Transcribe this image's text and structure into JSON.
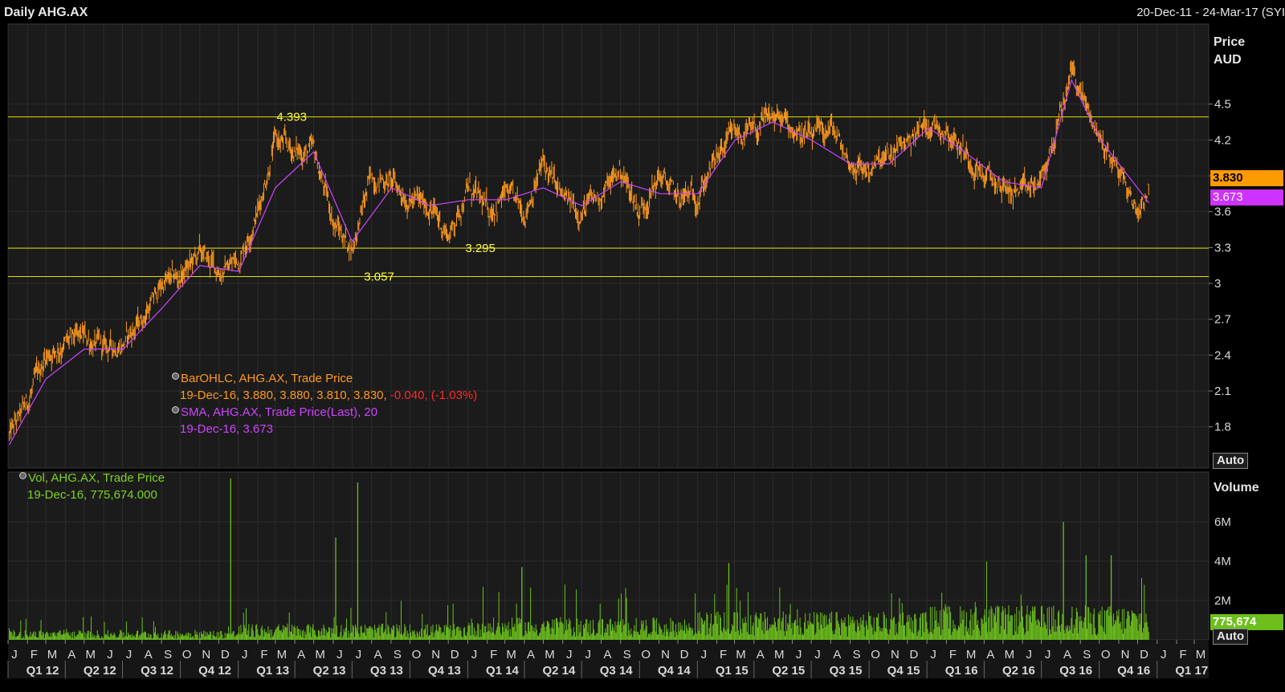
{
  "header": {
    "title": "Daily AHG.AX",
    "date_range": "20-Dec-11 - 24-Mar-17 (SYI"
  },
  "price_panel": {
    "axis_label_line1": "Price",
    "axis_label_line2": "AUD",
    "y_ticks": [
      "4.5",
      "4.2",
      "3.9",
      "3.6",
      "3.3",
      "3",
      "2.7",
      "2.4",
      "2.1",
      "1.8"
    ],
    "auto_label": "Auto",
    "last_price_tag": "3.830",
    "sma_tag": "3.673",
    "tag_colors": {
      "price": "#ff9a00",
      "sma": "#cc33ff"
    }
  },
  "volume_panel": {
    "axis_label": "Volume",
    "y_ticks": [
      "6M",
      "4M",
      "2M"
    ],
    "last_volume_tag": "775,674",
    "auto_label": "Auto"
  },
  "legend": {
    "bar_title": "BarOHLC, AHG.AX, Trade Price",
    "bar_values": "19-Dec-16, 3.880, 3.880, 3.810, 3.830,",
    "bar_change": "-0.040, (-1.03%)",
    "sma_title": "SMA, AHG.AX, Trade Price(Last),  20",
    "sma_values": "19-Dec-16, 3.673",
    "vol_title": "Vol, AHG.AX, Trade Price",
    "vol_values": "19-Dec-16, 775,674.000"
  },
  "chart_data": {
    "type": "bar",
    "subtype": "ohlc",
    "title": "Daily AHG.AX",
    "x_range": [
      "2012-01-01",
      "2017-03-24"
    ],
    "ylim": [
      1.6,
      4.9
    ],
    "ylabel": "Price AUD",
    "grid": true,
    "levels": [
      {
        "label": "4.393",
        "value": 4.393
      },
      {
        "label": "3.295",
        "value": 3.295
      },
      {
        "label": "3.057",
        "value": 3.057
      }
    ],
    "price_series": {
      "name": "BarOHLC, AHG.AX, Trade Price",
      "color": "#ff9a1f",
      "x": [
        "2012-01-03",
        "2012-02-01",
        "2012-03-01",
        "2012-04-02",
        "2012-05-01",
        "2012-06-01",
        "2012-07-02",
        "2012-08-01",
        "2012-09-03",
        "2012-10-01",
        "2012-11-01",
        "2012-12-03",
        "2013-01-02",
        "2013-02-01",
        "2013-03-01",
        "2013-04-02",
        "2013-05-01",
        "2013-06-03",
        "2013-07-01",
        "2013-08-01",
        "2013-09-02",
        "2013-10-01",
        "2013-11-01",
        "2013-12-02",
        "2014-01-02",
        "2014-02-03",
        "2014-03-03",
        "2014-04-01",
        "2014-05-01",
        "2014-06-02",
        "2014-07-01",
        "2014-08-01",
        "2014-09-01",
        "2014-10-01",
        "2014-11-03",
        "2014-12-01",
        "2015-01-02",
        "2015-02-02",
        "2015-03-02",
        "2015-04-01",
        "2015-05-01",
        "2015-06-01",
        "2015-07-01",
        "2015-08-03",
        "2015-09-01",
        "2015-10-01",
        "2015-11-02",
        "2015-12-01",
        "2016-01-04",
        "2016-02-01",
        "2016-03-01",
        "2016-04-01",
        "2016-05-02",
        "2016-06-01",
        "2016-07-01",
        "2016-08-01",
        "2016-08-18",
        "2016-09-01",
        "2016-10-03",
        "2016-11-01",
        "2016-12-01",
        "2016-12-19"
      ],
      "close": [
        1.72,
        2.0,
        2.4,
        2.5,
        2.55,
        2.45,
        2.5,
        2.7,
        3.0,
        3.05,
        3.25,
        3.1,
        3.2,
        3.6,
        4.2,
        4.1,
        4.1,
        3.5,
        3.3,
        3.9,
        3.85,
        3.7,
        3.65,
        3.4,
        3.8,
        3.6,
        3.75,
        3.6,
        4.0,
        3.7,
        3.6,
        3.75,
        3.95,
        3.6,
        3.9,
        3.7,
        3.75,
        4.05,
        4.25,
        4.25,
        4.4,
        4.3,
        4.2,
        4.3,
        4.0,
        3.95,
        4.05,
        4.2,
        4.35,
        4.3,
        4.1,
        3.9,
        3.8,
        3.75,
        3.85,
        4.4,
        4.8,
        4.6,
        4.2,
        3.95,
        3.6,
        3.83
      ]
    },
    "sma_series": {
      "name": "SMA, AHG.AX, Trade Price(Last),  20",
      "color": "#cc44ff",
      "x": [
        "2012-01-03",
        "2012-03-01",
        "2012-05-01",
        "2012-07-02",
        "2012-09-03",
        "2012-11-01",
        "2013-01-02",
        "2013-03-01",
        "2013-05-01",
        "2013-07-01",
        "2013-09-02",
        "2013-11-01",
        "2014-01-02",
        "2014-03-03",
        "2014-05-01",
        "2014-07-01",
        "2014-09-01",
        "2014-11-03",
        "2015-01-02",
        "2015-03-02",
        "2015-05-01",
        "2015-07-01",
        "2015-09-01",
        "2015-11-02",
        "2016-01-04",
        "2016-03-01",
        "2016-05-02",
        "2016-07-01",
        "2016-08-18",
        "2016-10-03",
        "2016-12-19"
      ],
      "values": [
        1.65,
        2.2,
        2.45,
        2.45,
        2.8,
        3.15,
        3.1,
        3.8,
        4.1,
        3.35,
        3.8,
        3.65,
        3.7,
        3.7,
        3.8,
        3.65,
        3.85,
        3.75,
        3.75,
        4.2,
        4.35,
        4.2,
        4.0,
        4.0,
        4.3,
        4.1,
        3.85,
        3.8,
        4.7,
        4.2,
        3.673
      ]
    },
    "volume_series": {
      "name": "Vol, AHG.AX, Trade Price",
      "color": "#6cbf1c",
      "ylim": [
        0,
        8000000
      ],
      "spikes": [
        {
          "x": "2012-12-20",
          "value": 8200000
        },
        {
          "x": "2013-06-05",
          "value": 5200000
        },
        {
          "x": "2013-07-10",
          "value": 8000000
        },
        {
          "x": "2014-03-28",
          "value": 3700000
        },
        {
          "x": "2015-02-20",
          "value": 3900000
        },
        {
          "x": "2016-08-05",
          "value": 6000000
        },
        {
          "x": "2016-09-10",
          "value": 4300000
        },
        {
          "x": "2016-10-20",
          "value": 4300000
        }
      ],
      "typical_value": 700000,
      "last_value": 775674
    },
    "x_month_labels": [
      "J",
      "F",
      "M",
      "A",
      "M",
      "J",
      "J",
      "A",
      "S",
      "O",
      "N",
      "D"
    ],
    "x_quarter_labels": [
      "Q1 12",
      "Q2 12",
      "Q3 12",
      "Q4 12",
      "Q1 13",
      "Q2 13",
      "Q3 13",
      "Q4 13",
      "Q1 14",
      "Q2 14",
      "Q3 14",
      "Q4 14",
      "Q1 15",
      "Q2 15",
      "Q3 15",
      "Q4 15",
      "Q1 16",
      "Q2 16",
      "Q3 16",
      "Q4 16",
      "Q1 17"
    ]
  }
}
